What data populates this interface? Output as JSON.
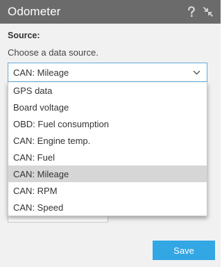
{
  "window": {
    "title": "Odometer",
    "help_icon": "question-mark-icon",
    "collapse_icon": "collapse-arrows-icon"
  },
  "source": {
    "label": "Source:",
    "hint": "Choose a data source.",
    "selected": "CAN: Mileage",
    "options": [
      "GPS data",
      "Board voltage",
      "OBD: Fuel consumption",
      "CAN: Engine temp.",
      "CAN: Fuel",
      "CAN: Mileage",
      "CAN: RPM",
      "CAN: Speed"
    ]
  },
  "footer": {
    "save_label": "Save"
  },
  "colors": {
    "titlebar": "#6b6b6b",
    "accent": "#33a6e4",
    "select_border": "#62a8d7",
    "option_highlight": "#d6d6d6"
  }
}
